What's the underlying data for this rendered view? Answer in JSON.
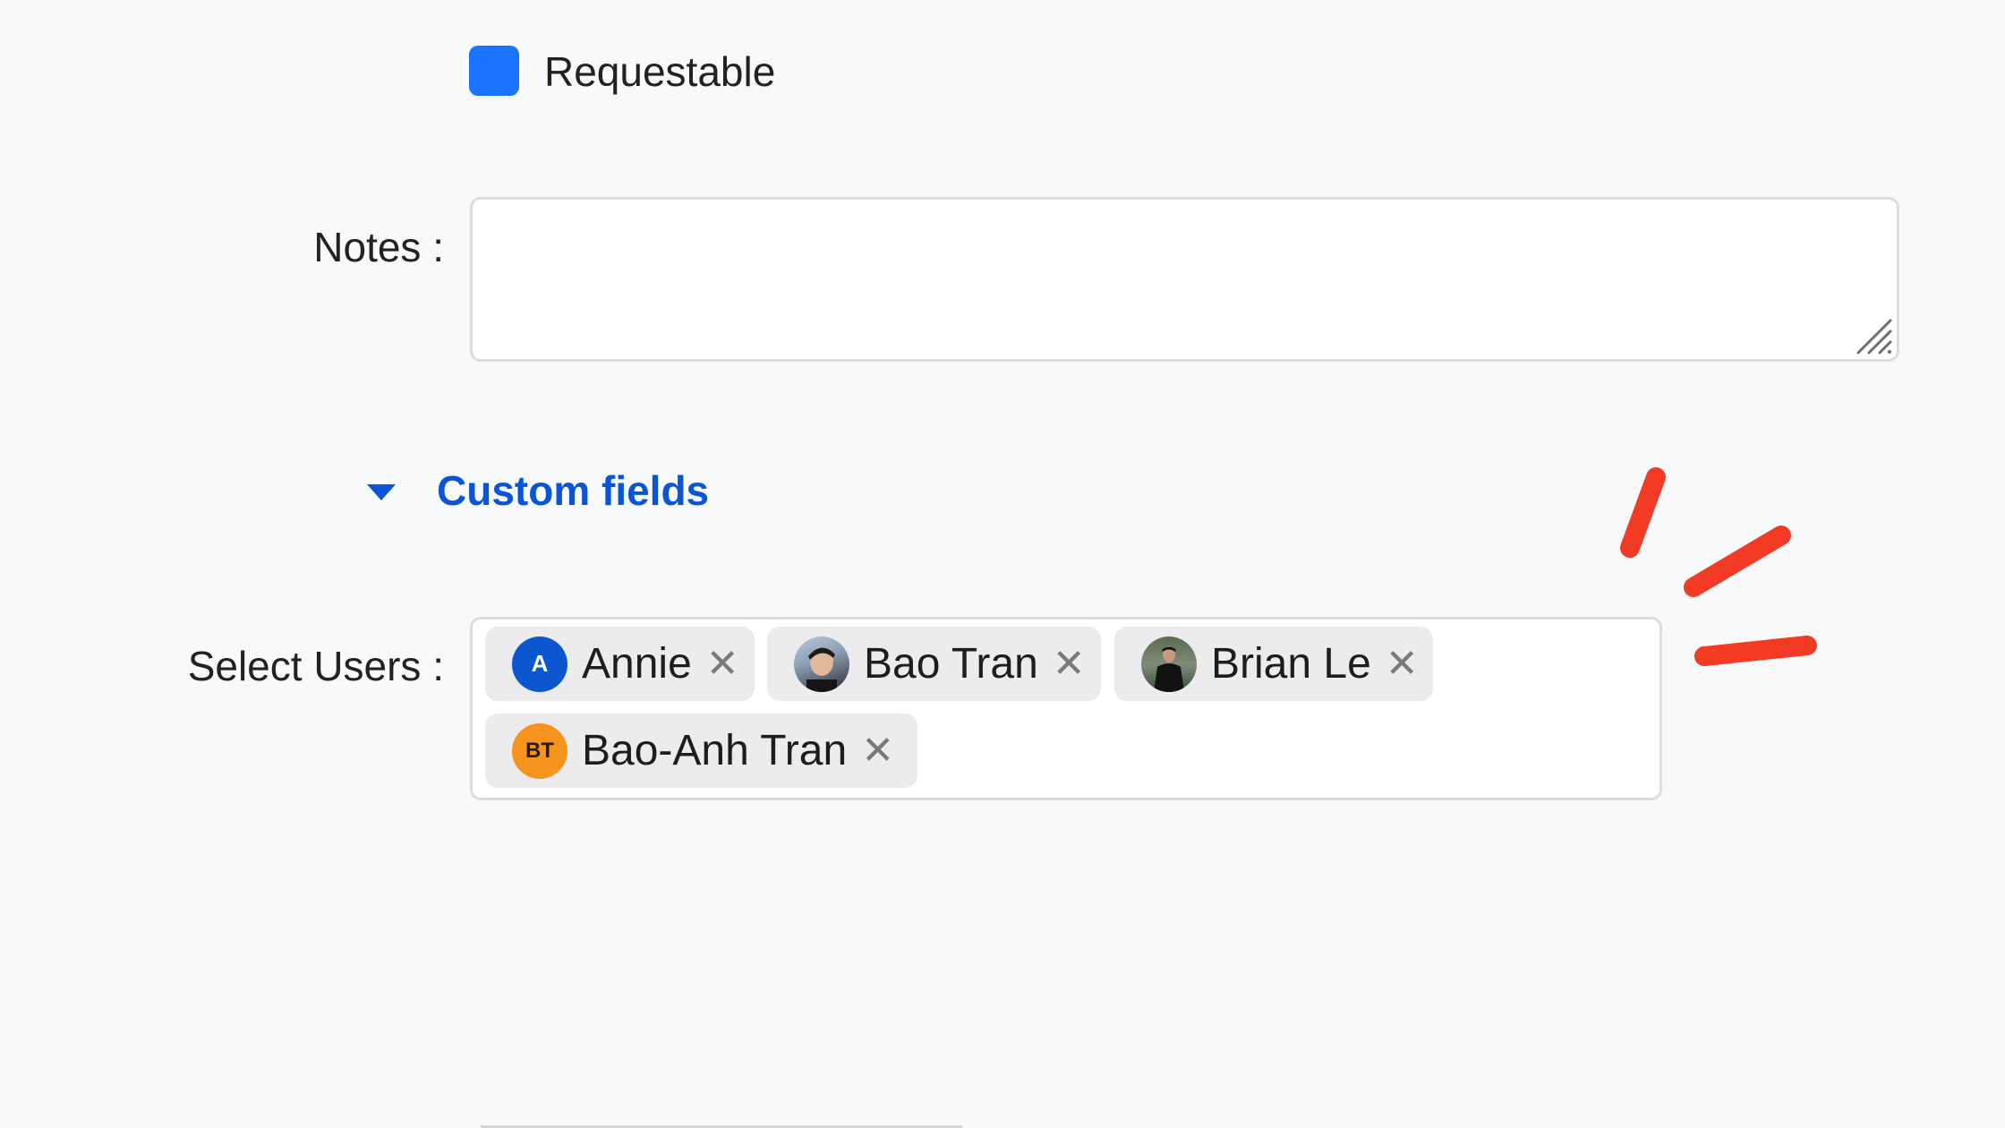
{
  "requestable": {
    "label": "Requestable",
    "checked": true,
    "color": "#1a73ff"
  },
  "notes": {
    "label": "Notes",
    "value": "",
    "placeholder": ""
  },
  "custom_fields": {
    "label": "Custom fields",
    "expanded": true,
    "color": "#0a55d6"
  },
  "select_users": {
    "label": "Select Users",
    "selected": [
      {
        "name": "Annie",
        "initials": "A",
        "avatar": "initials",
        "avatar_color": "#0b57d0"
      },
      {
        "name": "Bao Tran",
        "initials": "",
        "avatar": "photo",
        "avatar_color": "#8a9bb0"
      },
      {
        "name": "Brian Le",
        "initials": "",
        "avatar": "photo",
        "avatar_color": "#3c4a3a"
      },
      {
        "name": "Bao-Anh Tran",
        "initials": "BT",
        "avatar": "initials",
        "avatar_color": "#f7941d"
      }
    ],
    "remove_icon": "close-icon"
  },
  "annotation": {
    "type": "emphasis-marks",
    "color": "#f23a24"
  }
}
